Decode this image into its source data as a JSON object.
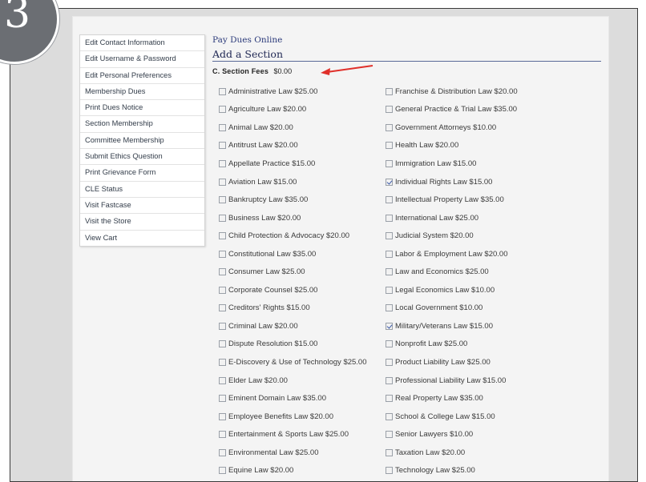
{
  "step": {
    "number": "3"
  },
  "sidebar": {
    "items": [
      {
        "label": "Edit Contact Information"
      },
      {
        "label": "Edit Username & Password"
      },
      {
        "label": "Edit Personal Preferences"
      },
      {
        "label": "Membership Dues"
      },
      {
        "label": "Print Dues Notice"
      },
      {
        "label": "Section Membership"
      },
      {
        "label": "Committee Membership"
      },
      {
        "label": "Submit Ethics Question"
      },
      {
        "label": "Print Grievance Form"
      },
      {
        "label": "CLE Status"
      },
      {
        "label": "Visit Fastcase"
      },
      {
        "label": "Visit the Store"
      },
      {
        "label": "View Cart"
      }
    ]
  },
  "main": {
    "pay_link": "Pay Dues Online",
    "title": "Add a Section",
    "fees_label": "C. Section Fees",
    "fees_value": "$0.00"
  },
  "sections": {
    "left": [
      {
        "label": "Administrative Law $25.00",
        "checked": false
      },
      {
        "label": "Agriculture Law $20.00",
        "checked": false
      },
      {
        "label": "Animal Law $20.00",
        "checked": false
      },
      {
        "label": "Antitrust Law $20.00",
        "checked": false
      },
      {
        "label": "Appellate Practice $15.00",
        "checked": false
      },
      {
        "label": "Aviation Law $15.00",
        "checked": false
      },
      {
        "label": "Bankruptcy Law $35.00",
        "checked": false
      },
      {
        "label": "Business Law $20.00",
        "checked": false
      },
      {
        "label": "Child Protection & Advocacy $20.00",
        "checked": false
      },
      {
        "label": "Constitutional Law $35.00",
        "checked": false
      },
      {
        "label": "Consumer Law $25.00",
        "checked": false
      },
      {
        "label": "Corporate Counsel $25.00",
        "checked": false
      },
      {
        "label": "Creditors' Rights $15.00",
        "checked": false
      },
      {
        "label": "Criminal Law $20.00",
        "checked": false
      },
      {
        "label": "Dispute Resolution $15.00",
        "checked": false
      },
      {
        "label": "E-Discovery & Use of Technology $25.00",
        "checked": false
      },
      {
        "label": "Elder Law $20.00",
        "checked": false
      },
      {
        "label": "Eminent Domain Law $35.00",
        "checked": false
      },
      {
        "label": "Employee Benefits Law $20.00",
        "checked": false
      },
      {
        "label": "Entertainment & Sports Law $25.00",
        "checked": false
      },
      {
        "label": "Environmental Law $25.00",
        "checked": false
      },
      {
        "label": "Equine Law $20.00",
        "checked": false
      }
    ],
    "right": [
      {
        "label": "Franchise & Distribution Law $20.00",
        "checked": false
      },
      {
        "label": "General Practice & Trial Law $35.00",
        "checked": false
      },
      {
        "label": "Government Attorneys $10.00",
        "checked": false
      },
      {
        "label": "Health Law $20.00",
        "checked": false
      },
      {
        "label": "Immigration Law $15.00",
        "checked": false
      },
      {
        "label": "Individual Rights Law $15.00",
        "checked": true
      },
      {
        "label": "Intellectual Property Law $35.00",
        "checked": false
      },
      {
        "label": "International Law $25.00",
        "checked": false
      },
      {
        "label": "Judicial System $20.00",
        "checked": false
      },
      {
        "label": "Labor & Employment Law $20.00",
        "checked": false
      },
      {
        "label": "Law and Economics $25.00",
        "checked": false
      },
      {
        "label": "Legal Economics Law $10.00",
        "checked": false
      },
      {
        "label": "Local Government $10.00",
        "checked": false
      },
      {
        "label": "Military/Veterans Law $15.00",
        "checked": true
      },
      {
        "label": "Nonprofit Law $25.00",
        "checked": false
      },
      {
        "label": "Product Liability Law $25.00",
        "checked": false
      },
      {
        "label": "Professional Liability Law $15.00",
        "checked": false
      },
      {
        "label": "Real Property Law $35.00",
        "checked": false
      },
      {
        "label": "School & College Law $15.00",
        "checked": false
      },
      {
        "label": "Senior Lawyers $10.00",
        "checked": false
      },
      {
        "label": "Taxation Law $20.00",
        "checked": false
      },
      {
        "label": "Technology Law $25.00",
        "checked": false
      }
    ]
  },
  "colors": {
    "annotation_arrow": "#e0302a",
    "step_circle": "#6b6e73",
    "link": "#2b3a7a"
  },
  "icons": {
    "annotation": "red-arrow-icon",
    "step": "step-number-icon"
  }
}
